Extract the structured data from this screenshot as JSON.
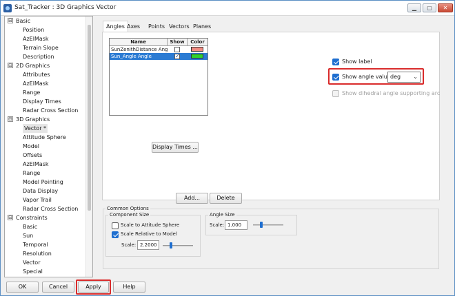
{
  "window": {
    "title": "Sat_Tracker : 3D Graphics Vector",
    "controls": {
      "minimize_icon": "minimize-icon",
      "maximize_icon": "maximize-icon",
      "close_icon": "close-icon"
    }
  },
  "tree": {
    "groups": [
      {
        "label": "Basic",
        "expander": "⊟",
        "items": [
          "Position",
          "AzElMask",
          "Terrain Slope",
          "Description"
        ]
      },
      {
        "label": "2D Graphics",
        "expander": "⊟",
        "items": [
          "Attributes",
          "AzElMask",
          "Range",
          "Display Times",
          "Radar Cross Section"
        ]
      },
      {
        "label": "3D Graphics",
        "expander": "⊟",
        "items": [
          "Vector *",
          "Attitude Sphere",
          "Model",
          "Offsets",
          "AzElMask",
          "Range",
          "Model Pointing",
          "Data Display",
          "Vapor Trail",
          "Radar Cross Section"
        ]
      },
      {
        "label": "Constraints",
        "expander": "⊟",
        "items": [
          "Basic",
          "Sun",
          "Temporal",
          "Resolution",
          "Vector",
          "Special"
        ]
      }
    ],
    "selected": "Vector *"
  },
  "tabs": [
    "Angles",
    "Axes",
    "Points",
    "Vectors",
    "Planes"
  ],
  "active_tab": "Angles",
  "angles_table": {
    "headers": {
      "name": "Name",
      "show": "Show",
      "color": "Color"
    },
    "rows": [
      {
        "name": "SunZenithDistance Angle",
        "show": false,
        "color": "#f28b82",
        "selected": false
      },
      {
        "name": "Sun_Angle Angle",
        "show": true,
        "color": "#31d22e",
        "selected": true
      }
    ]
  },
  "buttons": {
    "display_times": "Display Times ...",
    "add": "Add...",
    "delete": "Delete",
    "ok": "OK",
    "cancel": "Cancel",
    "apply": "Apply",
    "help": "Help"
  },
  "options": {
    "show_label": {
      "label": "Show label",
      "checked": true
    },
    "show_angle_value": {
      "label": "Show angle value",
      "checked": true
    },
    "angle_unit": {
      "value": "deg"
    },
    "show_dihedral": {
      "label": "Show dihedral angle supporting arc",
      "checked": false,
      "disabled": true
    }
  },
  "common_options": {
    "title": "Common Options",
    "component_size": {
      "title": "Component Size",
      "scale_to_attitude_sphere": {
        "label": "Scale to Attitude Sphere",
        "checked": false
      },
      "scale_relative_to_model": {
        "label": "Scale Relative to Model",
        "checked": true
      },
      "scale_label": "Scale:",
      "scale_value": "2.2000"
    },
    "angle_size": {
      "title": "Angle Size",
      "scale_label": "Scale:",
      "scale_value": "1.000"
    }
  },
  "colors": {
    "highlight_red": "#d92b2b",
    "selection_blue": "#2b7bd3",
    "checkbox_blue": "#1f6fd0"
  }
}
